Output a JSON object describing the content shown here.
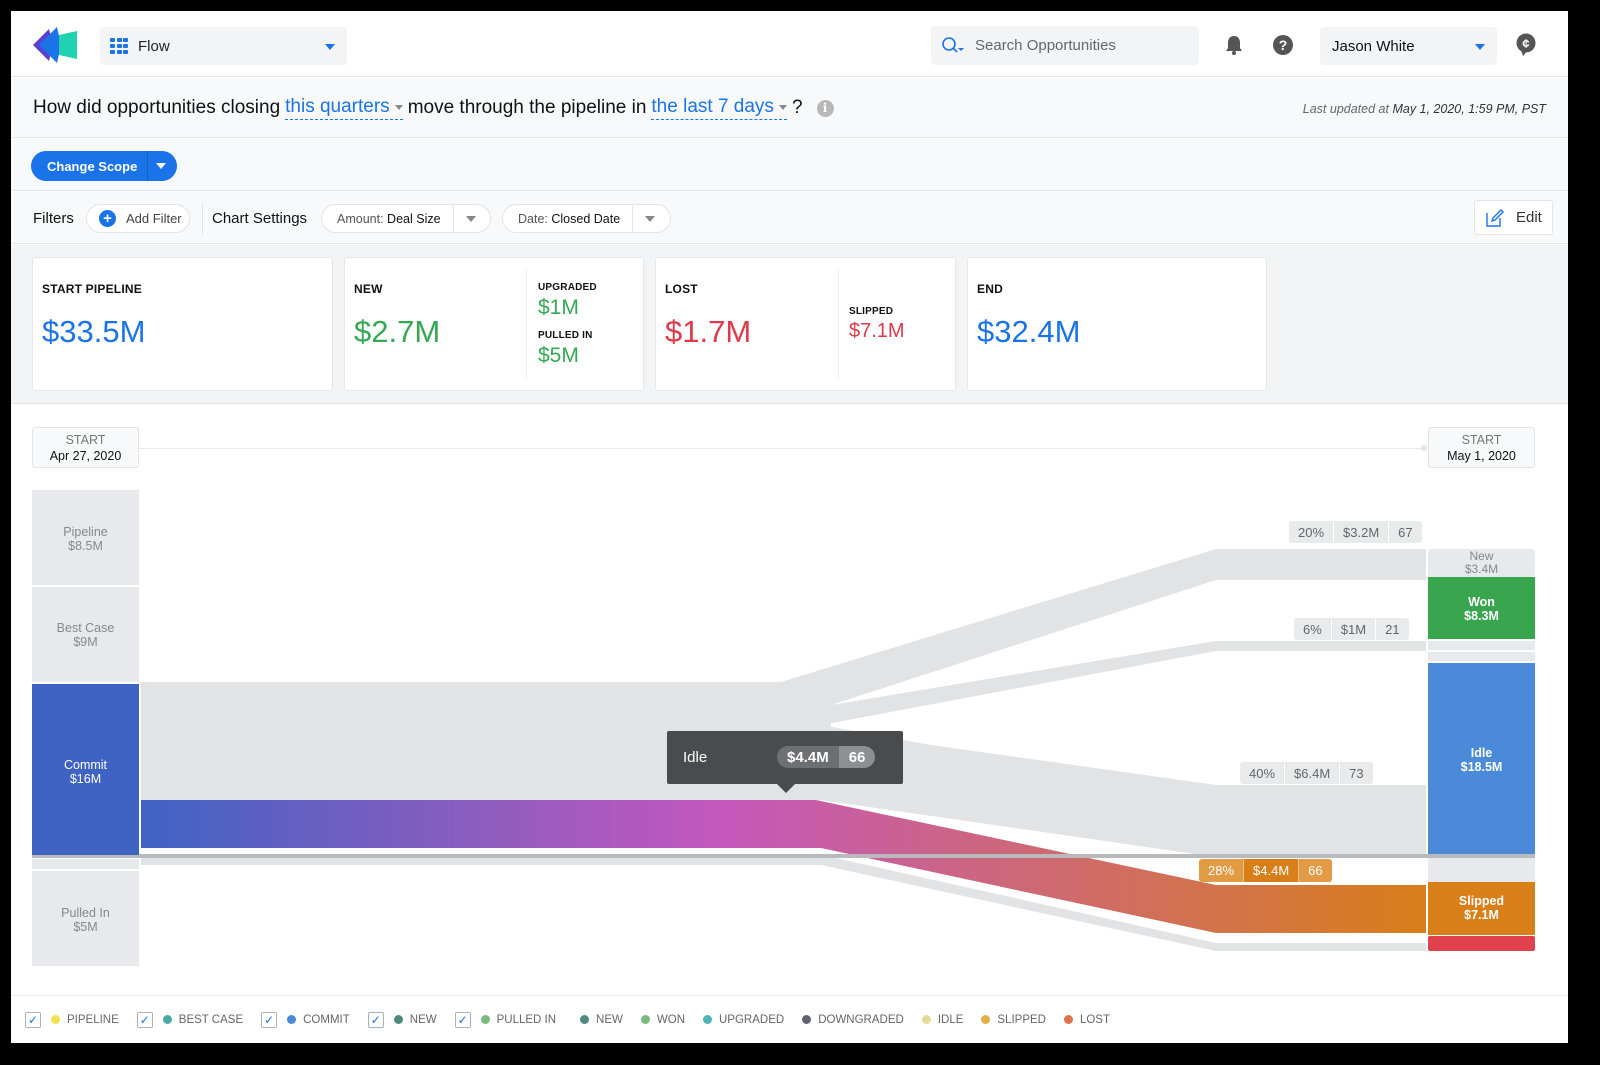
{
  "header": {
    "app_selector": {
      "label": "Flow",
      "icon": "grid-icon"
    },
    "search": {
      "placeholder": "Search Opportunities",
      "value": ""
    },
    "notifications_icon": "bell-icon",
    "help_icon": "help-icon",
    "user": {
      "name": "Jason White"
    },
    "currency_icon": "cent-chat-icon"
  },
  "question": {
    "prefix": "How did opportunities closing",
    "period_link": "this quarters",
    "middle": "move through the pipeline in",
    "range_link": "the last 7 days",
    "suffix": "?",
    "info_icon": "i"
  },
  "last_updated": {
    "prefix": "Last updated at",
    "value": "May 1, 2020, 1:59 PM, PST"
  },
  "scope": {
    "change_scope_label": "Change Scope"
  },
  "filters": {
    "label": "Filters",
    "add_filter_label": "Add Filter",
    "chart_settings_label": "Chart Settings",
    "amount": {
      "key": "Amount:",
      "value": "Deal Size"
    },
    "date": {
      "key": "Date:",
      "value": "Closed Date"
    },
    "edit_label": "Edit"
  },
  "cards": [
    {
      "title": "START PIPELINE",
      "value": "$33.5M"
    },
    {
      "title": "NEW",
      "value": "$2.7M",
      "sub": [
        {
          "title": "UPGRADED",
          "value": "$1M"
        },
        {
          "title": "PULLED IN",
          "value": "$5M"
        }
      ]
    },
    {
      "title": "LOST",
      "value": "$1.7M",
      "sub": [
        {
          "title": "SLIPPED",
          "value": "$7.1M"
        }
      ]
    },
    {
      "title": "END",
      "value": "$32.4M"
    }
  ],
  "flow": {
    "start": {
      "label": "START",
      "date": "Apr 27, 2020"
    },
    "end": {
      "label": "START",
      "date": "May 1, 2020"
    },
    "left_nodes": [
      {
        "name": "Pipeline",
        "value": "$8.5M",
        "color": "#e8e9ec"
      },
      {
        "name": "Best Case",
        "value": "$9M",
        "color": "#e8e9ec"
      },
      {
        "name": "Commit",
        "value": "$16M",
        "color": "#3f63c3",
        "selected": true
      },
      {
        "name": "Pulled In",
        "value": "$5M",
        "color": "#e8e9ec"
      }
    ],
    "right_nodes": [
      {
        "name": "New",
        "value": "$3.4M",
        "color": "#e8e9ec"
      },
      {
        "name": "Won",
        "value": "$8.3M",
        "color": "#3aa54f"
      },
      {
        "name": "Idle",
        "value": "$18.5M",
        "color": "#4a8ad9"
      },
      {
        "name": "Slipped",
        "value": "$7.1M",
        "color": "#d87f1a"
      },
      {
        "name": "Lost",
        "value": "",
        "color": "#e0414d"
      }
    ],
    "flow_badges": [
      {
        "percent": "20%",
        "amount": "$3.2M",
        "count": "67"
      },
      {
        "percent": "6%",
        "amount": "$1M",
        "count": "21"
      },
      {
        "percent": "40%",
        "amount": "$6.4M",
        "count": "73"
      },
      {
        "percent": "28%",
        "amount": "$4.4M",
        "count": "66",
        "highlight": true
      }
    ],
    "tooltip": {
      "label": "Idle",
      "amount": "$4.4M",
      "count": "66"
    },
    "gradient": {
      "from": "#3f63c3",
      "mid": "#c557bd",
      "to": "#d87f1a"
    }
  },
  "legend": [
    {
      "label": "PIPELINE",
      "color": "#f2e14c",
      "checked": true
    },
    {
      "label": "BEST CASE",
      "color": "#4aa9a5",
      "checked": true
    },
    {
      "label": "COMMIT",
      "color": "#4a8ad9",
      "checked": true
    },
    {
      "label": "NEW",
      "color": "#4f8a80",
      "checked": true
    },
    {
      "label": "PULLED IN",
      "color": "#78bb78",
      "checked": true
    },
    {
      "label": "NEW",
      "color": "#4f8a80"
    },
    {
      "label": "WON",
      "color": "#78bb78"
    },
    {
      "label": "UPGRADED",
      "color": "#4cb3b8"
    },
    {
      "label": "DOWNGRADED",
      "color": "#5d6275"
    },
    {
      "label": "IDLE",
      "color": "#e6d99a"
    },
    {
      "label": "SLIPPED",
      "color": "#e2ae4a"
    },
    {
      "label": "LOST",
      "color": "#e0714d"
    }
  ]
}
